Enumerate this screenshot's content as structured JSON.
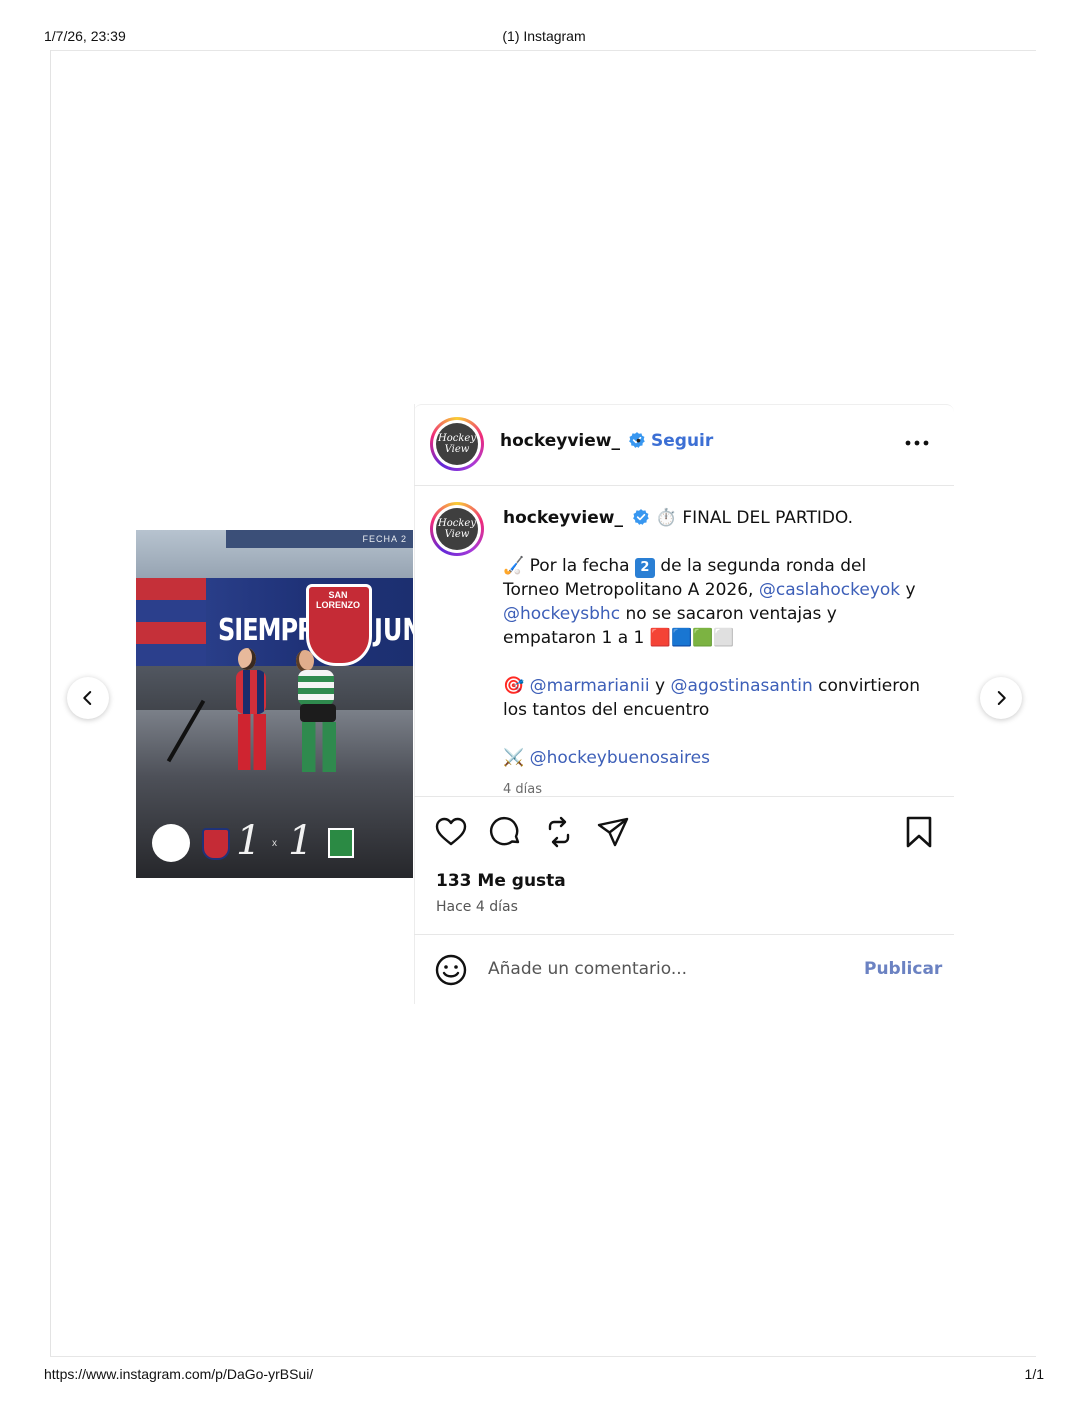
{
  "print_header": {
    "datetime": "1/7/26, 23:39",
    "title": "(1) Instagram"
  },
  "print_footer": {
    "url": "https://www.instagram.com/p/DaGo-yrBSui/",
    "pages": "1/1"
  },
  "media": {
    "banner_text_left": "SIEMPRE",
    "banner_text_right": "JUNT",
    "crest_text": "SAN LORENZO",
    "fecha": "FECHA 2",
    "score_left": "1",
    "score_sep": "x",
    "score_right": "1"
  },
  "header": {
    "username": "hockeyview_",
    "separator": "•",
    "follow_label": "Seguir",
    "avatar_text": "Hockey View"
  },
  "caption": {
    "username": "hockeyview_",
    "line1": "⏱️ FINAL DEL PARTIDO.",
    "p2_a": "🏑 Por la fecha ",
    "p2_num": "2",
    "p2_b": " de la segunda ronda del Torneo Metropolitano A 2026, ",
    "mention1": "@caslahockeyok",
    "p2_c": " y ",
    "mention2": "@hockeysbhc",
    "p2_d": " no se sacaron ventajas y empataron 1 a 1 ",
    "p2_end": "🟥🟦🟩⬜",
    "p3_emoji": "🎯",
    "mention3": "@marmarianii",
    "p3_a": " y ",
    "mention4": "@agostinasantin",
    "p3_b": " convirtieron los tantos del encuentro",
    "p4_emoji": "⚔️",
    "mention5": "@hockeybuenosaires",
    "time": "4 días"
  },
  "actions": {
    "likes": "133 Me gusta",
    "ago": "Hace 4 días"
  },
  "comment": {
    "placeholder": "Añade un comentario...",
    "publish_label": "Publicar"
  },
  "colors": {
    "link": "#3d5fb8",
    "follow": "#3c6fd4",
    "verified": "#3897f0"
  },
  "icons": [
    "chevron-left-icon",
    "chevron-right-icon",
    "verified-icon",
    "more-icon",
    "heart-icon",
    "comment-icon",
    "repost-icon",
    "share-icon",
    "bookmark-icon",
    "emoji-icon"
  ]
}
